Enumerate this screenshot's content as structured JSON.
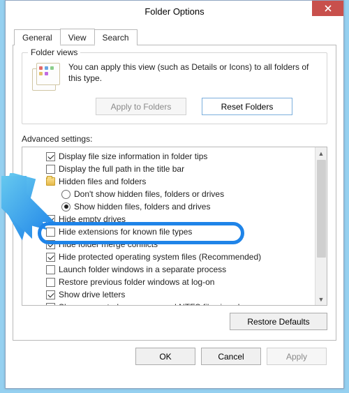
{
  "window": {
    "title": "Folder Options"
  },
  "tabs": {
    "general": "General",
    "view": "View",
    "search": "Search"
  },
  "folder_views": {
    "group_label": "Folder views",
    "desc": "You can apply this view (such as Details or Icons) to all folders of this type.",
    "apply_btn": "Apply to Folders",
    "reset_btn": "Reset Folders"
  },
  "advanced": {
    "label": "Advanced settings:",
    "items": [
      {
        "kind": "check",
        "checked": true,
        "indent": "sub",
        "text": "Display file size information in folder tips"
      },
      {
        "kind": "check",
        "checked": false,
        "indent": "sub",
        "text": "Display the full path in the title bar"
      },
      {
        "kind": "folder",
        "indent": "sub",
        "text": "Hidden files and folders"
      },
      {
        "kind": "radio",
        "checked": false,
        "indent": "subsub",
        "text": "Don't show hidden files, folders or drives"
      },
      {
        "kind": "radio",
        "checked": true,
        "indent": "subsub",
        "text": "Show hidden files, folders and drives"
      },
      {
        "kind": "check",
        "checked": true,
        "indent": "sub",
        "text": "Hide empty drives"
      },
      {
        "kind": "check",
        "checked": false,
        "indent": "sub",
        "text": "Hide extensions for known file types"
      },
      {
        "kind": "check",
        "checked": true,
        "indent": "sub",
        "text": "Hide folder merge conflicts"
      },
      {
        "kind": "check",
        "checked": true,
        "indent": "sub",
        "text": "Hide protected operating system files (Recommended)"
      },
      {
        "kind": "check",
        "checked": false,
        "indent": "sub",
        "text": "Launch folder windows in a separate process"
      },
      {
        "kind": "check",
        "checked": false,
        "indent": "sub",
        "text": "Restore previous folder windows at log-on"
      },
      {
        "kind": "check",
        "checked": true,
        "indent": "sub",
        "text": "Show drive letters"
      },
      {
        "kind": "check",
        "checked": true,
        "indent": "sub",
        "text": "Show encrypted or compressed NTFS files in colour"
      }
    ],
    "restore_btn": "Restore Defaults"
  },
  "dialog_buttons": {
    "ok": "OK",
    "cancel": "Cancel",
    "apply": "Apply"
  }
}
